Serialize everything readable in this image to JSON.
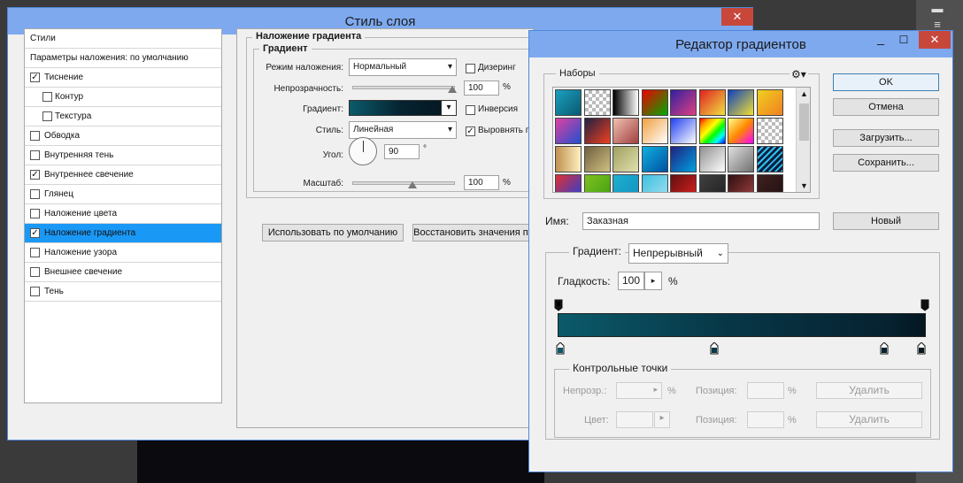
{
  "layer_style": {
    "title": "Стиль слоя",
    "styles_header": "Стили",
    "blend_defaults": "Параметры наложения: по умолчанию",
    "items": [
      {
        "label": "Тиснение",
        "checked": true,
        "indent": false,
        "selected": false
      },
      {
        "label": "Контур",
        "checked": false,
        "indent": true,
        "selected": false
      },
      {
        "label": "Текстура",
        "checked": false,
        "indent": true,
        "selected": false
      },
      {
        "label": "Обводка",
        "checked": false,
        "indent": false,
        "selected": false
      },
      {
        "label": "Внутренняя тень",
        "checked": false,
        "indent": false,
        "selected": false
      },
      {
        "label": "Внутреннее свечение",
        "checked": true,
        "indent": false,
        "selected": false
      },
      {
        "label": "Глянец",
        "checked": false,
        "indent": false,
        "selected": false
      },
      {
        "label": "Наложение цвета",
        "checked": false,
        "indent": false,
        "selected": false
      },
      {
        "label": "Наложение градиента",
        "checked": true,
        "indent": false,
        "selected": true
      },
      {
        "label": "Наложение узора",
        "checked": false,
        "indent": false,
        "selected": false
      },
      {
        "label": "Внешнее свечение",
        "checked": false,
        "indent": false,
        "selected": false
      },
      {
        "label": "Тень",
        "checked": false,
        "indent": false,
        "selected": false
      }
    ],
    "section_title": "Наложение градиента",
    "sub_title": "Градиент",
    "blend_mode_label": "Режим наложения:",
    "blend_mode_value": "Нормальный",
    "dither_label": "Дизеринг",
    "opacity_label": "Непрозрачность:",
    "opacity_value": "100",
    "opacity_unit": "%",
    "gradient_label": "Градиент:",
    "reverse_label": "Инверсия",
    "style_label": "Стиль:",
    "style_value": "Линейная",
    "align_label": "Выровнять п",
    "angle_label": "Угол:",
    "angle_value": "90",
    "angle_unit": "°",
    "scale_label": "Масштаб:",
    "scale_value": "100",
    "scale_unit": "%",
    "use_default_btn": "Использовать по умолчанию",
    "restore_default_btn": "Восстановить значения по"
  },
  "gradient_editor": {
    "title": "Редактор градиентов",
    "presets_label": "Наборы",
    "ok_btn": "OK",
    "cancel_btn": "Отмена",
    "load_btn": "Загрузить...",
    "save_btn": "Сохранить...",
    "name_label": "Имя:",
    "name_value": "Заказная",
    "new_btn": "Новый",
    "gradient_type_label": "Градиент:",
    "gradient_type_value": "Непрерывный",
    "smoothness_label": "Гладкость:",
    "smoothness_value": "100",
    "smoothness_unit": "%",
    "stops_title": "Контрольные точки",
    "opacity_label": "Непрозр.:",
    "opacity_unit": "%",
    "position_label": "Позиция:",
    "position_unit": "%",
    "delete_btn": "Удалить",
    "color_label": "Цвет:",
    "position_label2": "Позиция:",
    "position_unit2": "%",
    "delete_btn2": "Удалить"
  },
  "colors": {
    "titlebar": "#7ea9ee",
    "selection": "#1a98f5",
    "close": "#c7473b",
    "gradient_start": "#0b5a6a",
    "gradient_end": "#041620"
  }
}
